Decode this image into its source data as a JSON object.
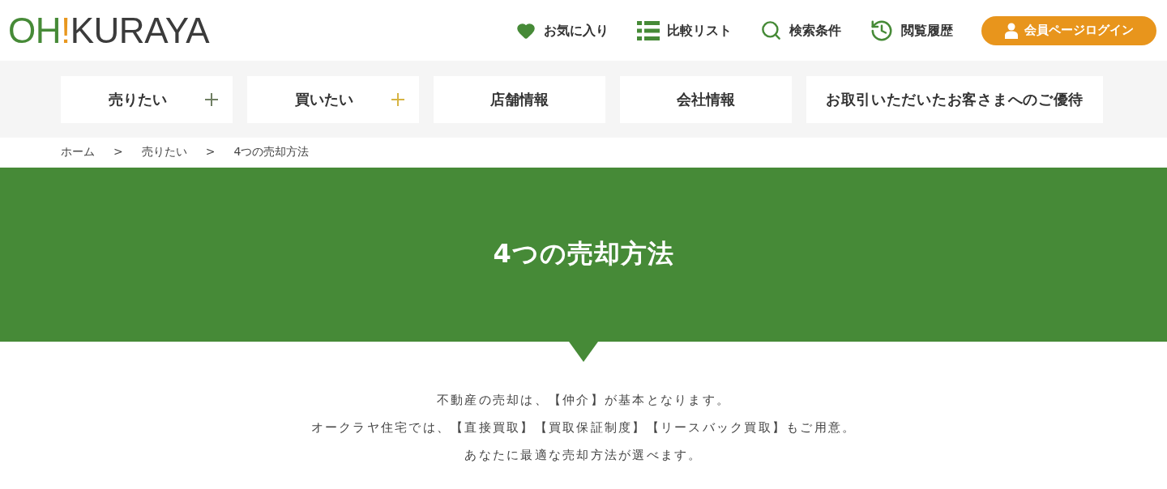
{
  "header": {
    "logo": [
      {
        "text": "OH",
        "color": "#468a37"
      },
      {
        "text": "!",
        "color": "#e8971e"
      },
      {
        "text": "KURAYA",
        "color": "#3b3b3b"
      }
    ],
    "links": [
      {
        "label": "お気に入り",
        "kind": "heart"
      },
      {
        "label": "比較リスト",
        "kind": "list"
      },
      {
        "label": "検索条件",
        "kind": "search"
      },
      {
        "label": "閲覧履歴",
        "kind": "history"
      }
    ],
    "login_button": {
      "label": "会員ページログイン"
    }
  },
  "main_nav": [
    {
      "label": "売りたい",
      "has_submenu": true,
      "color": "#6f7f63"
    },
    {
      "label": "買いたい",
      "has_submenu": true,
      "color": "#d6b443"
    },
    {
      "label": "店舗情報",
      "has_submenu": false
    },
    {
      "label": "会社情報",
      "has_submenu": false
    },
    {
      "label": "お取引いただいたお客さまへのご優待",
      "has_submenu": false
    }
  ],
  "breadcrumb": {
    "items": [
      "ホーム",
      "売りたい",
      "4つの売却方法"
    ],
    "separators": [
      ">",
      ">"
    ]
  },
  "hero": {
    "title": "4つの売却方法"
  },
  "intro": {
    "lines": [
      "不動産の売却は、【仲介】が基本となります。",
      "オークラヤ住宅では、【直接買取】【買取保証制度】【リースバック買取】もご用意。",
      "あなたに最適な売却方法が選べます。"
    ]
  }
}
